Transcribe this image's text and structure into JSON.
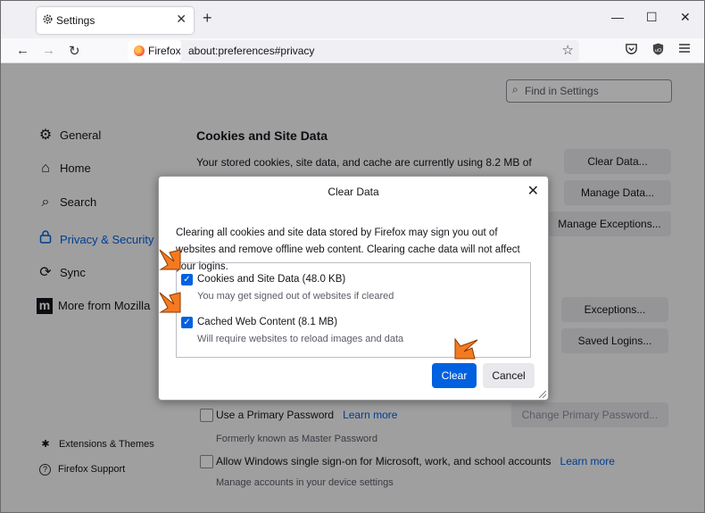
{
  "tab": {
    "title": "Settings",
    "close": "✕"
  },
  "toolbar": {
    "new_tab": "+",
    "min": "—",
    "max": "☐",
    "close": "✕"
  },
  "nav": {
    "back": "←",
    "forward": "→",
    "reload": "↻",
    "identity": "Firefox",
    "url": "about:preferences#privacy",
    "star": "☆"
  },
  "find": {
    "placeholder": "Find in Settings",
    "icon": "⌕"
  },
  "sidebar": {
    "items": [
      {
        "label": "General",
        "icon": "⚙"
      },
      {
        "label": "Home",
        "icon": "⌂"
      },
      {
        "label": "Search",
        "icon": "⌕"
      },
      {
        "label": "Privacy & Security",
        "icon": "🔒"
      },
      {
        "label": "Sync",
        "icon": "⟳"
      },
      {
        "label": "More from Mozilla",
        "icon": "m"
      }
    ],
    "bottom": [
      {
        "label": "Extensions & Themes",
        "icon": "✱"
      },
      {
        "label": "Firefox Support",
        "icon": "?"
      }
    ]
  },
  "cookies": {
    "heading": "Cookies and Site Data",
    "desc": "Your stored cookies, site data, and cache are currently using 8.2 MB of",
    "clear_data": "Clear Data...",
    "manage_data": "Manage Data...",
    "manage_exceptions": "Manage Exceptions..."
  },
  "logins": {
    "exceptions": "Exceptions...",
    "saved_logins": "Saved Logins..."
  },
  "primary_password": {
    "label": "Use a Primary Password",
    "learn_more": "Learn more",
    "change": "Change Primary Password...",
    "note": "Formerly known as Master Password"
  },
  "sso": {
    "label": "Allow Windows single sign-on for Microsoft, work, and school accounts",
    "learn_more": "Learn more",
    "note": "Manage accounts in your device settings"
  },
  "dialog": {
    "title": "Clear Data",
    "close": "✕",
    "desc": "Clearing all cookies and site data stored by Firefox may sign you out of websites and remove offline web content. Clearing cache data will not affect your logins.",
    "opt1_label": "Cookies and Site Data (48.0 KB)",
    "opt1_sub": "You may get signed out of websites if cleared",
    "opt2_label": "Cached Web Content (8.1 MB)",
    "opt2_sub": "Will require websites to reload images and data",
    "check": "✓",
    "clear": "Clear",
    "cancel": "Cancel"
  },
  "colors": {
    "accent": "#0061e0",
    "annotation_arrow": "#f47a20"
  }
}
